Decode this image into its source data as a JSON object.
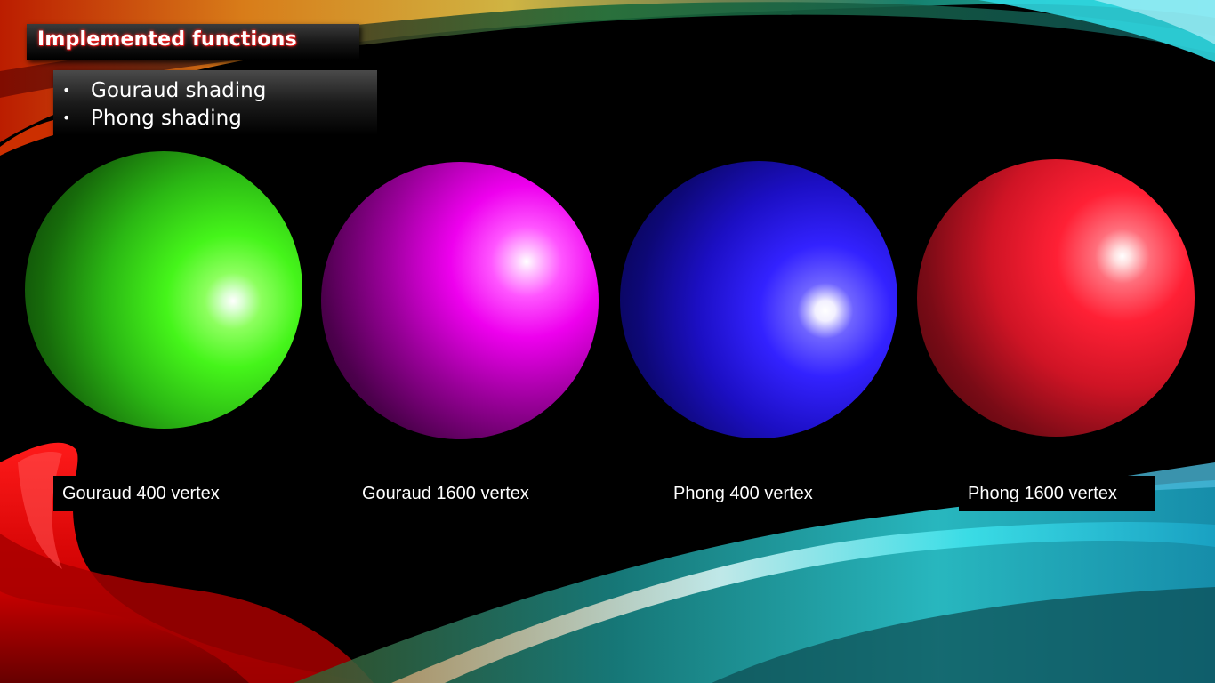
{
  "slide": {
    "title": "Implemented functions",
    "bullets": [
      {
        "marker": "•",
        "text": "Gouraud shading"
      },
      {
        "marker": "•",
        "text": "Phong shading"
      }
    ],
    "spheres": [
      {
        "label": "Gouraud 400 vertex",
        "color": "#33ff11"
      },
      {
        "label": "Gouraud 1600 vertex",
        "color": "#ff00ff"
      },
      {
        "label": "Phong 400 vertex",
        "color": "#2b1bff"
      },
      {
        "label": "Phong 1600 vertex",
        "color": "#ff1e30"
      }
    ]
  },
  "colors": {
    "background": "#000000",
    "title_glow": "#ff2a2a",
    "wave_orange": "#f08a1c",
    "wave_red": "#e00000",
    "wave_cyan": "#2fd7e0"
  }
}
